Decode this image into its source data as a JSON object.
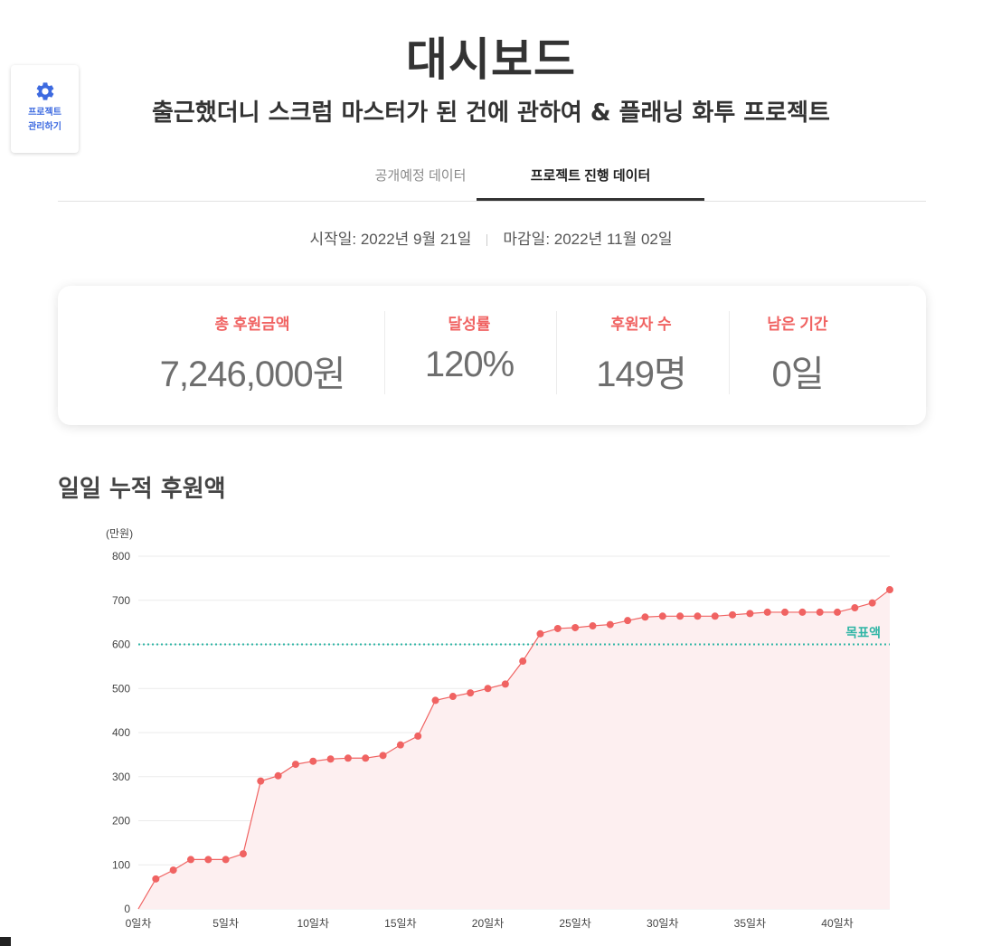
{
  "manage": {
    "icon": "gear-icon",
    "label": "프로젝트 관리하기",
    "color": "#3d6ae0"
  },
  "header": {
    "title": "대시보드",
    "subtitle": "출근했더니 스크럼 마스터가 된 건에 관하여 & 플래닝 화투 프로젝트"
  },
  "tabs": [
    {
      "label": "공개예정 데이터",
      "active": false
    },
    {
      "label": "프로젝트 진행 데이터",
      "active": true
    }
  ],
  "dates": {
    "start": "시작일: 2022년 9월 21일",
    "end": "마감일: 2022년 11월 02일"
  },
  "stats": [
    {
      "label": "총 후원금액",
      "value": "7,246,000원"
    },
    {
      "label": "달성률",
      "value": "120%"
    },
    {
      "label": "후원자 수",
      "value": "149명"
    },
    {
      "label": "남은 기간",
      "value": "0일"
    }
  ],
  "colors": {
    "accent": "#f06362",
    "goal": "#2fb5a5",
    "line": "#f06362",
    "area": "#fdeff0"
  },
  "section": {
    "title": "일일 누적 후원액"
  },
  "chart_data": {
    "type": "area",
    "unit_label": "(만원)",
    "ylim": [
      0,
      800
    ],
    "y_ticks": [
      "0",
      "100",
      "200",
      "300",
      "400",
      "500",
      "600",
      "700",
      "800"
    ],
    "xlim": [
      0,
      43
    ],
    "x_ticks": [
      {
        "x": 0,
        "label": "0일차"
      },
      {
        "x": 5,
        "label": "5일차"
      },
      {
        "x": 10,
        "label": "10일차"
      },
      {
        "x": 15,
        "label": "15일차"
      },
      {
        "x": 20,
        "label": "20일차"
      },
      {
        "x": 25,
        "label": "25일차"
      },
      {
        "x": 30,
        "label": "30일차"
      },
      {
        "x": 35,
        "label": "35일차"
      },
      {
        "x": 40,
        "label": "40일차"
      }
    ],
    "x": [
      0,
      1,
      2,
      3,
      4,
      5,
      6,
      7,
      8,
      9,
      10,
      11,
      12,
      13,
      14,
      15,
      16,
      17,
      18,
      19,
      20,
      21,
      22,
      23,
      24,
      25,
      26,
      27,
      28,
      29,
      30,
      31,
      32,
      33,
      34,
      35,
      36,
      37,
      38,
      39,
      40,
      41,
      42,
      43
    ],
    "values": [
      0,
      68,
      88,
      112,
      112,
      112,
      125,
      290,
      302,
      328,
      335,
      340,
      342,
      342,
      348,
      372,
      392,
      473,
      482,
      490,
      500,
      510,
      562,
      624,
      636,
      638,
      642,
      645,
      654,
      662,
      664,
      664,
      664,
      664,
      667,
      670,
      673,
      673,
      673,
      673,
      673,
      683,
      694,
      724
    ],
    "goal": {
      "value": 600,
      "label": "목표액"
    },
    "grid": true
  }
}
